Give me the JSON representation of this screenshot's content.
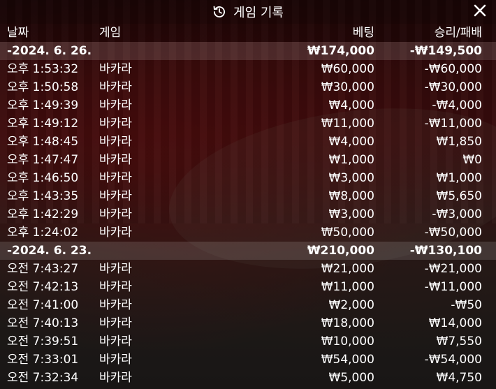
{
  "title": "게임 기록",
  "icons": {
    "history": "history-icon",
    "close": "close-icon"
  },
  "columns": {
    "date": "날짜",
    "game": "게임",
    "bet": "베팅",
    "winloss": "승리/패배"
  },
  "groups": [
    {
      "date": "-2024. 6. 26.",
      "bet": "₩174,000",
      "winloss": "-₩149,500",
      "rows": [
        {
          "time": "오후 1:53:32",
          "game": "바카라",
          "bet": "₩60,000",
          "winloss": "-₩60,000"
        },
        {
          "time": "오후 1:50:58",
          "game": "바카라",
          "bet": "₩30,000",
          "winloss": "-₩30,000"
        },
        {
          "time": "오후 1:49:39",
          "game": "바카라",
          "bet": "₩4,000",
          "winloss": "-₩4,000"
        },
        {
          "time": "오후 1:49:12",
          "game": "바카라",
          "bet": "₩11,000",
          "winloss": "-₩11,000"
        },
        {
          "time": "오후 1:48:45",
          "game": "바카라",
          "bet": "₩4,000",
          "winloss": "₩1,850"
        },
        {
          "time": "오후 1:47:47",
          "game": "바카라",
          "bet": "₩1,000",
          "winloss": "₩0"
        },
        {
          "time": "오후 1:46:50",
          "game": "바카라",
          "bet": "₩3,000",
          "winloss": "₩1,000"
        },
        {
          "time": "오후 1:43:35",
          "game": "바카라",
          "bet": "₩8,000",
          "winloss": "₩5,650"
        },
        {
          "time": "오후 1:42:29",
          "game": "바카라",
          "bet": "₩3,000",
          "winloss": "-₩3,000"
        },
        {
          "time": "오후 1:24:02",
          "game": "바카라",
          "bet": "₩50,000",
          "winloss": "-₩50,000"
        }
      ]
    },
    {
      "date": "-2024. 6. 23.",
      "bet": "₩210,000",
      "winloss": "-₩130,100",
      "rows": [
        {
          "time": "오전 7:43:27",
          "game": "바카라",
          "bet": "₩21,000",
          "winloss": "-₩21,000"
        },
        {
          "time": "오전 7:42:13",
          "game": "바카라",
          "bet": "₩11,000",
          "winloss": "-₩11,000"
        },
        {
          "time": "오전 7:41:00",
          "game": "바카라",
          "bet": "₩2,000",
          "winloss": "-₩50"
        },
        {
          "time": "오전 7:40:13",
          "game": "바카라",
          "bet": "₩18,000",
          "winloss": "₩14,000"
        },
        {
          "time": "오전 7:39:51",
          "game": "바카라",
          "bet": "₩10,000",
          "winloss": "₩7,550"
        },
        {
          "time": "오전 7:33:01",
          "game": "바카라",
          "bet": "₩54,000",
          "winloss": "-₩54,000"
        },
        {
          "time": "오전 7:32:34",
          "game": "바카라",
          "bet": "₩5,000",
          "winloss": "₩4,750"
        }
      ]
    }
  ]
}
